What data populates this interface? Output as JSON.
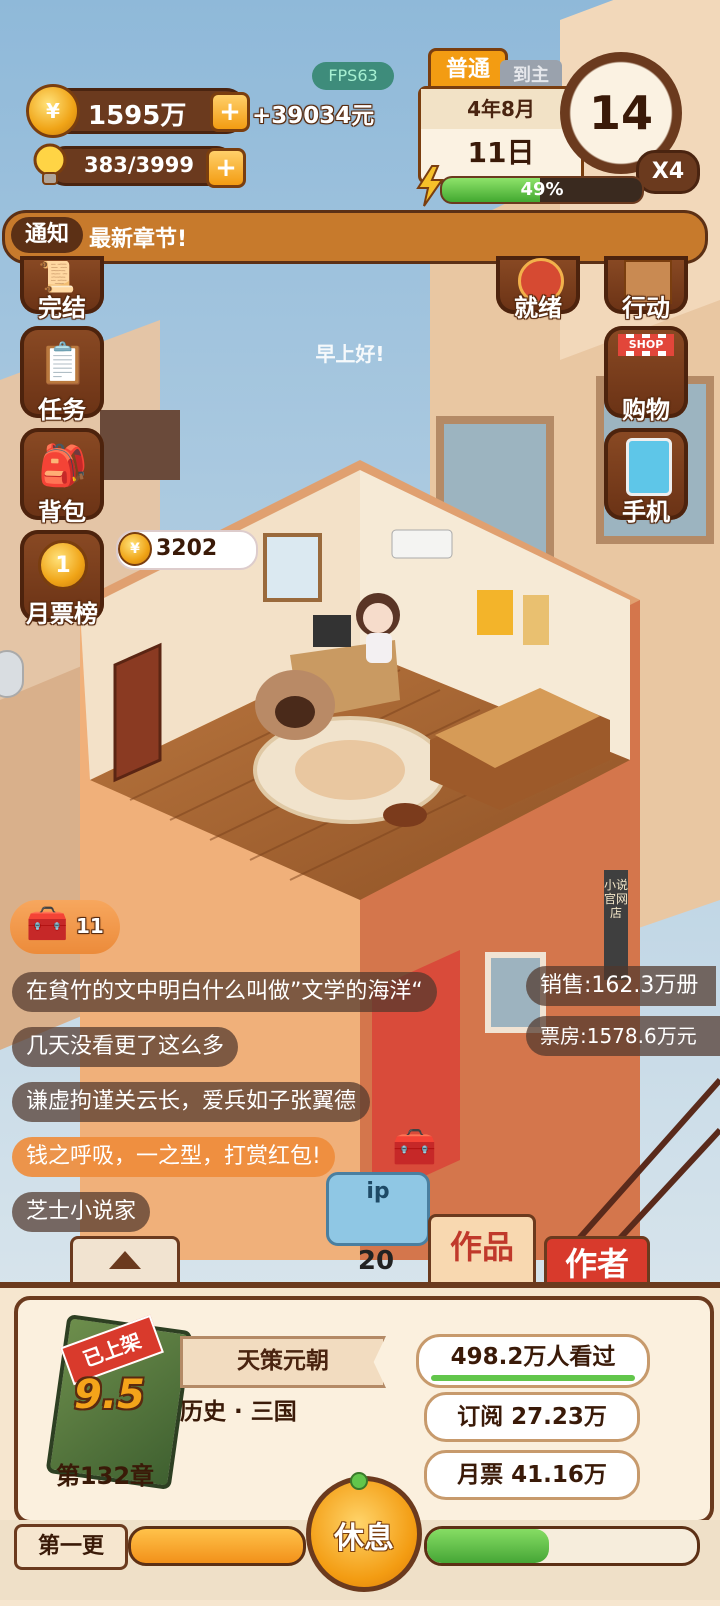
{
  "hud": {
    "fps": "FPS63",
    "money": "1595万",
    "money_rate": "+39034元",
    "energy": "383/3999",
    "difficulty": "普通",
    "side_tab": "到主",
    "date_month": "4年8月",
    "date_day": "11日",
    "clock_value": "14",
    "speed": "X4",
    "progress_label": "49%",
    "progress_value": 0.49
  },
  "notice": {
    "tag": "通知",
    "text": "最新章节!"
  },
  "left_menu": [
    {
      "label": "完结",
      "icon": "scroll-icon"
    },
    {
      "label": "任务",
      "icon": "checklist-icon"
    },
    {
      "label": "背包",
      "icon": "backpack-icon"
    },
    {
      "label": "月票榜",
      "icon": "medal-icon"
    }
  ],
  "right_menu": [
    {
      "label": "就绪",
      "icon": "ready-icon"
    },
    {
      "label": "行动",
      "icon": "door-icon"
    },
    {
      "label": "购物",
      "icon": "shop-icon"
    },
    {
      "label": "手机",
      "icon": "phone-icon"
    }
  ],
  "shop_sign": "SHOP",
  "greeting": "早上好!",
  "coin_bubble": "3202",
  "chest_count": "11",
  "store_sign": "小说官网店",
  "chat_lines": [
    "在貧竹的文中明白什么叫做”文学的海洋“",
    "几天没看更了这么多",
    "谦虚拘谨关云长，爱兵如子张翼德",
    "钱之呼吸，一之型，打赏红包!",
    "芝士小说家"
  ],
  "stats": {
    "sales": "销售:162.3万册",
    "box_office": "票房:1578.6万元"
  },
  "ip": {
    "label": "ip",
    "count": "20"
  },
  "tabs": {
    "works": "作品",
    "author": "作者"
  },
  "book": {
    "badge": "已上架",
    "rating": "9.5",
    "title": "天策元朝",
    "genre": "历史 · 三国",
    "chapter": "第132章",
    "views": "498.2万人看过",
    "views_progress": 1.0,
    "subscriptions": "订阅 27.23万",
    "monthly_tickets": "月票 41.16万"
  },
  "bottom": {
    "update_button": "第一更",
    "rest_button": "休息",
    "left_progress": 1.0,
    "right_progress": 0.45
  },
  "colors": {
    "brown_dark": "#5c3015",
    "orange": "#f39c12",
    "green": "#5ec24a",
    "panel": "#f6e6cf"
  }
}
